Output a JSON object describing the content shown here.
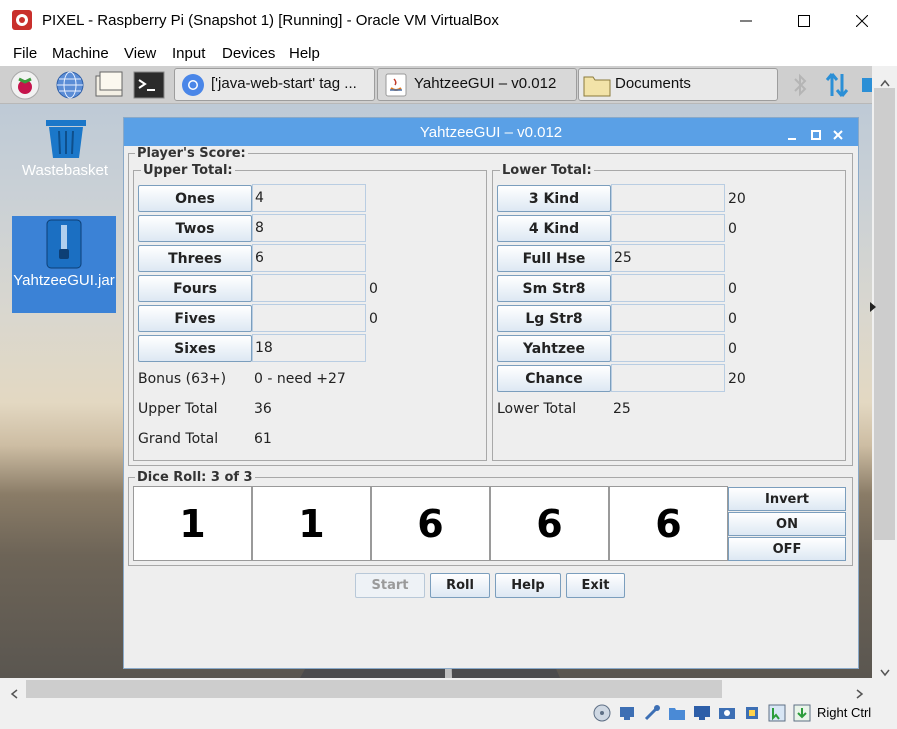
{
  "host_window": {
    "title": "PIXEL - Raspberry Pi (Snapshot 1) [Running] - Oracle VM VirtualBox",
    "menu": [
      "File",
      "Machine",
      "View",
      "Input",
      "Devices",
      "Help"
    ],
    "minimize_icon": "minimize-icon",
    "maximize_icon": "maximize-icon",
    "close_icon": "close-icon"
  },
  "guest_panel": {
    "tasks": [
      {
        "label": "['java-web-start' tag ...",
        "icon": "chromium-icon"
      },
      {
        "label": "YahtzeeGUI – v0.012",
        "icon": "java-icon"
      },
      {
        "label": "Documents",
        "icon": "folder-icon"
      }
    ]
  },
  "desktop": {
    "icons": [
      {
        "label": "Wastebasket",
        "icon": "trash-icon"
      },
      {
        "label": "YahtzeeGUI.jar",
        "icon": "archive-icon"
      }
    ]
  },
  "app": {
    "title": "YahtzeeGUI – v0.012",
    "score_group": "Player's Score:",
    "upper_group": "Upper Total:",
    "lower_group": "Lower Total:",
    "upper_rows": [
      {
        "label": "Ones",
        "left": "4",
        "right": ""
      },
      {
        "label": "Twos",
        "left": "8",
        "right": ""
      },
      {
        "label": "Threes",
        "left": "6",
        "right": ""
      },
      {
        "label": "Fours",
        "left": "",
        "right": "0"
      },
      {
        "label": "Fives",
        "left": "",
        "right": "0"
      },
      {
        "label": "Sixes",
        "left": "18",
        "right": ""
      }
    ],
    "bonus_label": "Bonus (63+)",
    "bonus_value": "0 - need +27",
    "upper_total_label": "Upper Total",
    "upper_total_value": "36",
    "grand_total_label": "Grand Total",
    "grand_total_value": "61",
    "lower_rows": [
      {
        "label": "3 Kind",
        "left": "",
        "right": "20"
      },
      {
        "label": "4 Kind",
        "left": "",
        "right": "0"
      },
      {
        "label": "Full Hse",
        "left": "25",
        "right": ""
      },
      {
        "label": "Sm Str8",
        "left": "",
        "right": "0"
      },
      {
        "label": "Lg Str8",
        "left": "",
        "right": "0"
      },
      {
        "label": "Yahtzee",
        "left": "",
        "right": "0"
      },
      {
        "label": "Chance",
        "left": "",
        "right": "20"
      }
    ],
    "lower_total_label": "Lower Total",
    "lower_total_value": "25",
    "dice_group": "Dice Roll: 3 of 3",
    "dice": [
      "1",
      "1",
      "6",
      "6",
      "6"
    ],
    "dice_buttons": [
      "Invert",
      "ON",
      "OFF"
    ],
    "buttons": {
      "start": "Start",
      "roll": "Roll",
      "help": "Help",
      "exit": "Exit"
    }
  },
  "status": {
    "host_key": "Right Ctrl"
  },
  "colors": {
    "app_title_bar": "#5aa0e6",
    "button_border": "#7b9ebd"
  }
}
